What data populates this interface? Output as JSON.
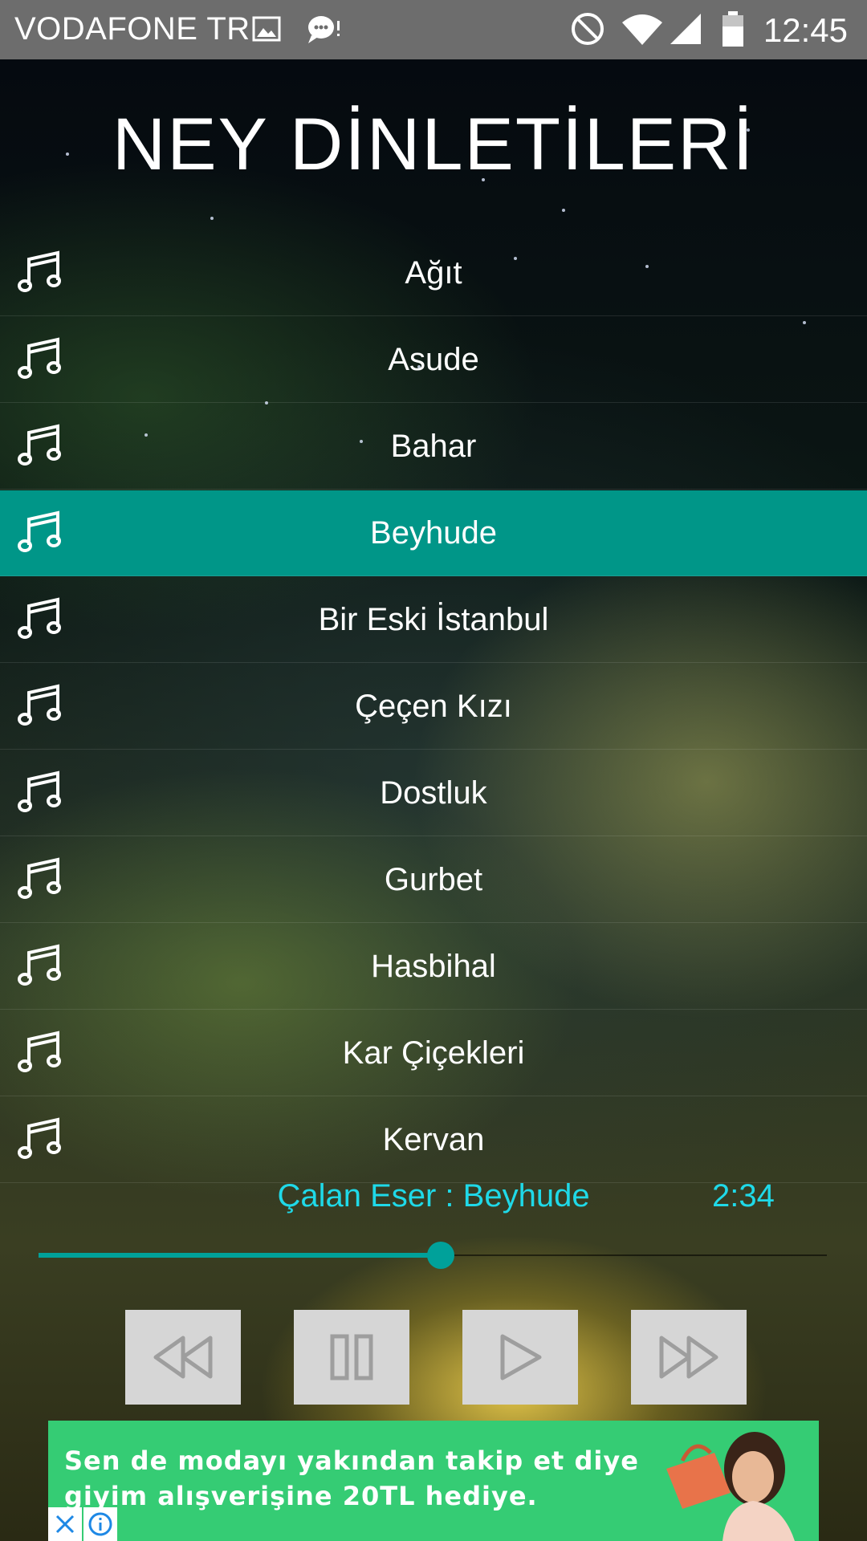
{
  "status_bar": {
    "carrier": "VODAFONE TR",
    "time": "12:45",
    "icons": [
      "image-icon",
      "chat-icon",
      "no-disturb-icon",
      "wifi-icon",
      "signal-icon",
      "battery-icon"
    ]
  },
  "header": {
    "title": "NEY DİNLETİLERİ"
  },
  "songs": {
    "items": [
      {
        "label": "Ağıt"
      },
      {
        "label": "Asude"
      },
      {
        "label": "Bahar"
      },
      {
        "label": "Beyhude",
        "active": true
      },
      {
        "label": "Bir Eski İstanbul"
      },
      {
        "label": "Çeçen Kızı"
      },
      {
        "label": "Dostluk"
      },
      {
        "label": "Gurbet"
      },
      {
        "label": "Hasbihal"
      },
      {
        "label": "Kar Çiçekleri"
      },
      {
        "label": "Kervan"
      }
    ],
    "icon": "music-note-icon"
  },
  "player": {
    "now_playing": "Çalan Eser : Beyhude",
    "elapsed": "2:34",
    "progress_fraction": 0.51,
    "accent_color": "#009688",
    "text_color": "#1fd9e8",
    "controls": [
      "rewind-icon",
      "pause-icon",
      "play-icon",
      "fast-forward-icon"
    ]
  },
  "ad": {
    "text": "Sen de modayı yakından takip et diye giyim alışverişine 20TL hediye.",
    "background_color": "#35cc74"
  }
}
